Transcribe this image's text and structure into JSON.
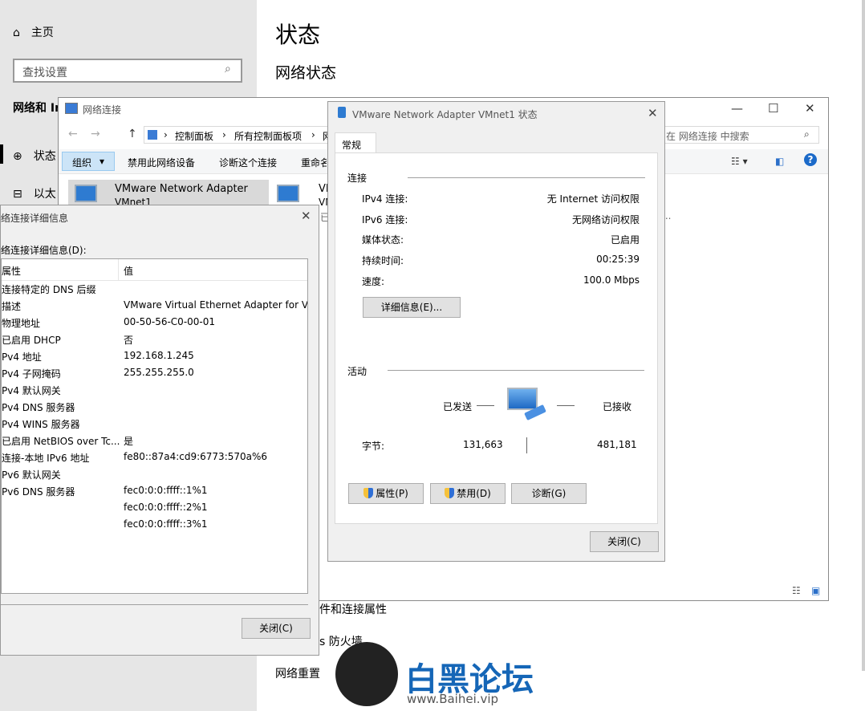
{
  "settings": {
    "home_label": "主页",
    "search_placeholder": "查找设置",
    "section_heading": "网络和 Ir",
    "nav": [
      {
        "label": "状态"
      },
      {
        "label": "以太"
      }
    ],
    "title": "状态",
    "subtitle": "网络状态",
    "links": [
      "件和连接属性",
      "s 防火墙",
      "网络重置"
    ]
  },
  "net_window": {
    "title": "网络连接",
    "breadcrumb": [
      "控制面板",
      "所有控制面板项",
      "网"
    ],
    "search_placeholder": "在 网络连接 中搜索",
    "toolbar": [
      "组织",
      "禁用此网络设备",
      "诊断这个连接",
      "重命名"
    ],
    "adapter1": {
      "name": "VMware Network Adapter",
      "sub": "VMnet1"
    },
    "adapter2": {
      "name": "VM",
      "sub": "VM"
    },
    "partial_text": "已",
    "ellipsis": "..."
  },
  "details": {
    "title": "络连接详细信息",
    "label": "络连接详细信息(D):",
    "col_property": "属性",
    "col_value": "值",
    "rows": [
      {
        "k": "连接特定的 DNS 后缀",
        "v": ""
      },
      {
        "k": "描述",
        "v": "VMware Virtual Ethernet Adapter for VM"
      },
      {
        "k": "物理地址",
        "v": "00-50-56-C0-00-01"
      },
      {
        "k": "已启用 DHCP",
        "v": "否"
      },
      {
        "k": "Pv4 地址",
        "v": "192.168.1.245"
      },
      {
        "k": "Pv4 子网掩码",
        "v": "255.255.255.0"
      },
      {
        "k": "Pv4 默认网关",
        "v": ""
      },
      {
        "k": "Pv4 DNS 服务器",
        "v": ""
      },
      {
        "k": "Pv4 WINS 服务器",
        "v": ""
      },
      {
        "k": "已启用 NetBIOS over Tc...",
        "v": "是"
      },
      {
        "k": "连接-本地 IPv6 地址",
        "v": "fe80::87a4:cd9:6773:570a%6"
      },
      {
        "k": "Pv6 默认网关",
        "v": ""
      },
      {
        "k": "Pv6 DNS 服务器",
        "v": "fec0:0:0:ffff::1%1"
      },
      {
        "k": "",
        "v": "fec0:0:0:ffff::2%1"
      },
      {
        "k": "",
        "v": "fec0:0:0:ffff::3%1"
      }
    ],
    "close_label": "关闭(C)"
  },
  "status_dialog": {
    "title": "VMware Network Adapter VMnet1 状态",
    "tab": "常规",
    "connection_heading": "连接",
    "fields": [
      {
        "k": "IPv4 连接:",
        "v": "无 Internet 访问权限"
      },
      {
        "k": "IPv6 连接:",
        "v": "无网络访问权限"
      },
      {
        "k": "媒体状态:",
        "v": "已启用"
      },
      {
        "k": "持续时间:",
        "v": "00:25:39"
      },
      {
        "k": "速度:",
        "v": "100.0 Mbps"
      }
    ],
    "details_button": "详细信息(E)...",
    "activity_heading": "活动",
    "sent_label": "已发送",
    "received_label": "已接收",
    "bytes_label": "字节:",
    "bytes_sent": "131,663",
    "bytes_received": "481,181",
    "properties_button": "属性(P)",
    "disable_button": "禁用(D)",
    "diagnose_button": "诊断(G)",
    "close_button": "关闭(C)"
  },
  "watermark": {
    "text": "白黑论坛",
    "url": "www.Baihei.vip"
  }
}
